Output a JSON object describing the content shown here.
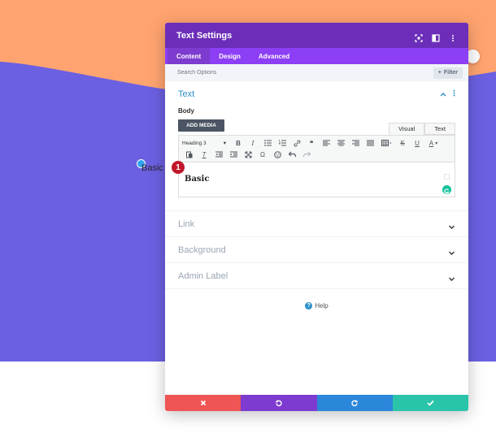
{
  "colors": {
    "peach": "#ffa470",
    "purple_bg": "#6b60e1",
    "header_purple": "#6c2eb9",
    "tabs_purple": "#8c3ff5",
    "accent_blue": "#2c8fc9",
    "discard_red": "#ef5555",
    "undo_purple": "#7e3bd0",
    "redo_blue": "#2b87da",
    "save_green": "#29c4a9",
    "badge_red": "#c0172b"
  },
  "canvas": {
    "text": "Basic"
  },
  "modal": {
    "title": "Text Settings",
    "tabs": [
      "Content",
      "Design",
      "Advanced"
    ],
    "search": {
      "placeholder": "Search Options"
    },
    "filter_label": "Filter",
    "text_section": {
      "title": "Text",
      "body_label": "Body",
      "add_media": "ADD MEDIA",
      "editor_tabs": [
        "Visual",
        "Text"
      ],
      "format_select": "Heading 3",
      "content": "Basic"
    },
    "sections": [
      "Link",
      "Background",
      "Admin Label"
    ],
    "help": "Help"
  },
  "badge": "1"
}
